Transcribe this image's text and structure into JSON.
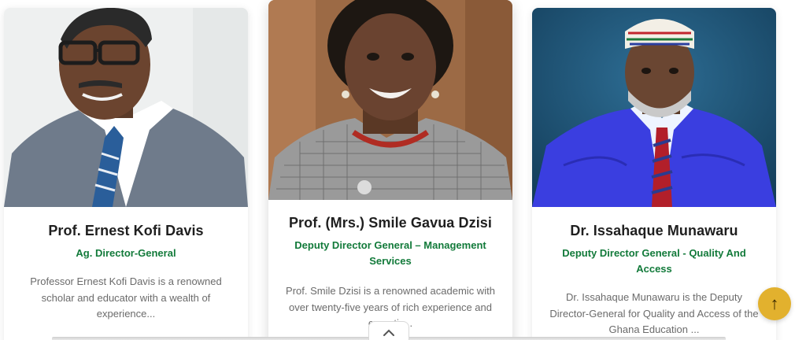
{
  "cards": [
    {
      "name": "Prof. Ernest Kofi Davis",
      "role": "Ag. Director-General",
      "description": "Professor Ernest Kofi Davis is a renowned scholar and educator with a wealth of experience..."
    },
    {
      "name": "Prof. (Mrs.) Smile Gavua Dzisi",
      "role": "Deputy Director General – Management Services",
      "description": "Prof. Smile Dzisi is a renowned academic with over twenty-five years of rich experience and expertis..."
    },
    {
      "name": "Dr. Issahaque Munawaru",
      "role": "Deputy Director General - Quality And Access",
      "description": "Dr. Issahaque Munawaru is the Deputy Director-General for Quality and Access of the Ghana Education ..."
    }
  ],
  "scroll_top": {
    "icon": "arrow-up-icon",
    "glyph": "↑"
  },
  "collapse": {
    "icon": "chevron-up-icon"
  },
  "colors": {
    "role_text": "#127a3a",
    "scroll_button": "#e2b12e"
  }
}
